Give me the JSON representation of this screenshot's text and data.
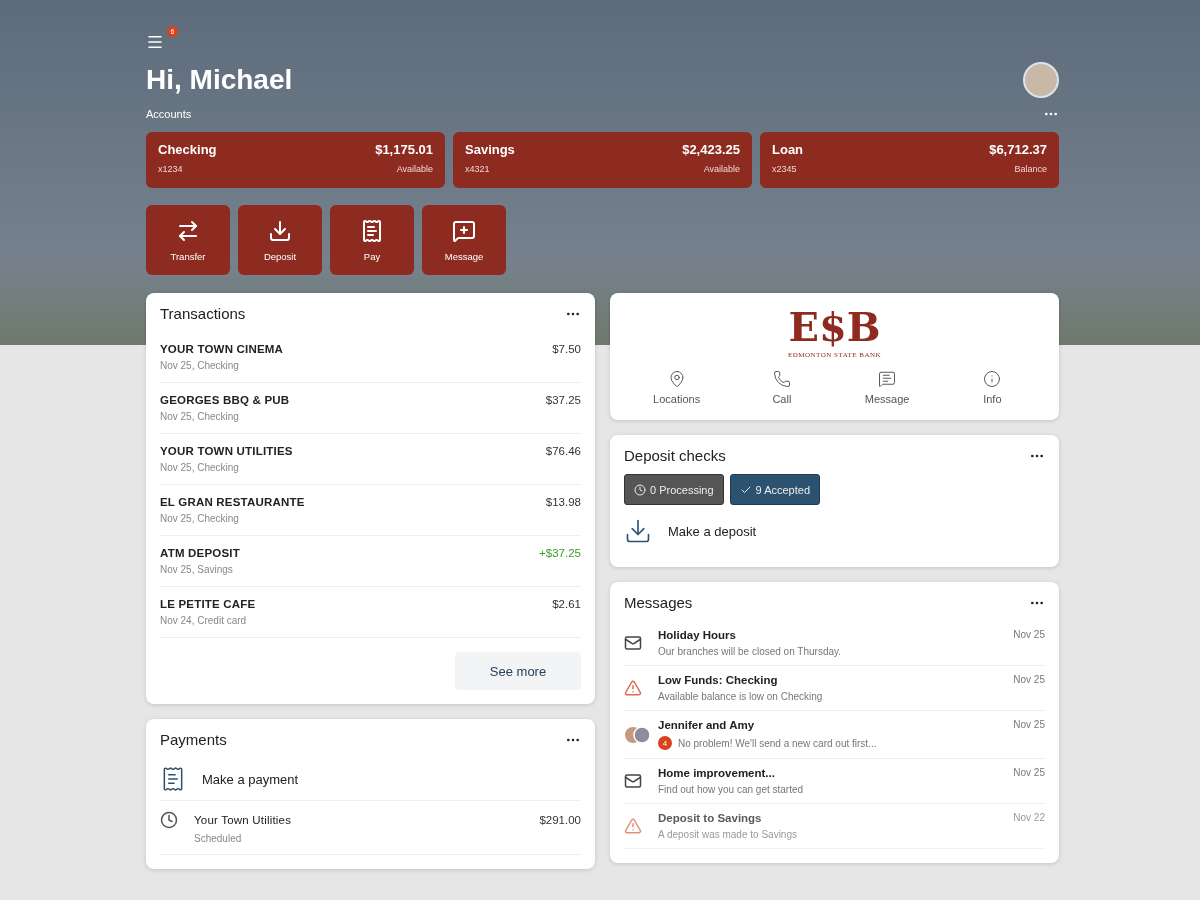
{
  "menu_badge": "6",
  "greeting": "Hi, Michael",
  "accounts": {
    "title": "Accounts",
    "items": [
      {
        "name": "Checking",
        "number": "x1234",
        "amount": "$1,175.01",
        "note": "Available"
      },
      {
        "name": "Savings",
        "number": "x4321",
        "amount": "$2,423.25",
        "note": "Available"
      },
      {
        "name": "Loan",
        "number": "x2345",
        "amount": "$6,712.37",
        "note": "Balance"
      }
    ]
  },
  "actions": [
    {
      "kind": "transfer",
      "label": "Transfer"
    },
    {
      "kind": "deposit",
      "label": "Deposit"
    },
    {
      "kind": "pay",
      "label": "Pay"
    },
    {
      "kind": "message",
      "label": "Message"
    }
  ],
  "transactions": {
    "title": "Transactions",
    "rows": [
      {
        "name": "YOUR TOWN CINEMA",
        "detail": "Nov 25, Checking",
        "amount": "$7.50",
        "kind": "debit"
      },
      {
        "name": "GEORGES BBQ & PUB",
        "detail": "Nov 25, Checking",
        "amount": "$37.25",
        "kind": "debit"
      },
      {
        "name": "YOUR TOWN UTILITIES",
        "detail": "Nov 25, Checking",
        "amount": "$76.46",
        "kind": "debit"
      },
      {
        "name": "EL GRAN RESTAURANTE",
        "detail": "Nov 25, Checking",
        "amount": "$13.98",
        "kind": "debit"
      },
      {
        "name": "ATM DEPOSIT",
        "detail": "Nov 25, Savings",
        "amount": "+$37.25",
        "kind": "credit"
      },
      {
        "name": "LE PETITE CAFE",
        "detail": "Nov 24, Credit card",
        "amount": "$2.61",
        "kind": "debit"
      }
    ],
    "button": "See more"
  },
  "payments": {
    "title": "Payments",
    "action": "Make a payment",
    "rows": [
      {
        "name": "Your Town Utilities",
        "detail": "Scheduled",
        "amount": "$291.00"
      }
    ]
  },
  "bank": {
    "logo": "E$B",
    "name": "EDMONTON STATE BANK",
    "links": [
      {
        "kind": "pin",
        "label": "Locations"
      },
      {
        "kind": "phone",
        "label": "Call"
      },
      {
        "kind": "chat",
        "label": "Message"
      },
      {
        "kind": "info",
        "label": "Info"
      }
    ]
  },
  "deposits": {
    "title": "Deposit checks",
    "chips": [
      {
        "kind": "processing",
        "label": "0 Processing",
        "selected": false
      },
      {
        "kind": "accepted",
        "label": "9 Accepted",
        "selected": true
      }
    ],
    "action": "Make a deposit"
  },
  "messages": {
    "title": "Messages",
    "rows": [
      {
        "kind": "mail",
        "title": "Holiday Hours",
        "preview": "Our branches will be closed on Thursday.",
        "date": "Nov 25",
        "disabled": false
      },
      {
        "kind": "warning",
        "title": "Low Funds: Checking",
        "preview": "Available balance is low on Checking",
        "date": "Nov 25",
        "disabled": false
      },
      {
        "kind": "people",
        "title": "Jennifer and Amy",
        "preview": "No problem! We'll send a new card out first...",
        "date": "Nov 25",
        "badge": "4",
        "disabled": false
      },
      {
        "kind": "mail",
        "title": "Home improvement...",
        "preview": "Find out how you can get started",
        "date": "Nov 25",
        "disabled": false
      },
      {
        "kind": "warning",
        "title": "Deposit to Savings",
        "preview": "A deposit was made to Savings",
        "date": "Nov 22",
        "disabled": true
      }
    ]
  }
}
